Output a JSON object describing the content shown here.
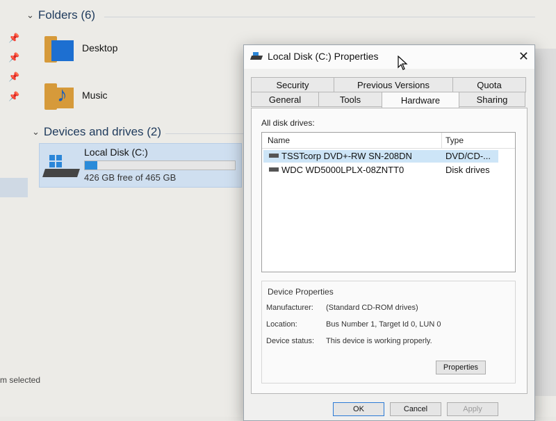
{
  "explorer": {
    "folders_header": "Folders (6)",
    "folders": [
      {
        "label": "Desktop",
        "icon": "desktop-folder-icon"
      },
      {
        "label": "Music",
        "icon": "music-folder-icon"
      }
    ],
    "devices_header": "Devices and drives (2)",
    "drive": {
      "name": "Local Disk (C:)",
      "free_text": "426 GB free of 465 GB",
      "used_fraction": 0.084
    },
    "status_text": "m selected"
  },
  "dialog": {
    "title": "Local Disk (C:) Properties",
    "close_glyph": "✕",
    "tabs_row1": [
      "Security",
      "Previous Versions",
      "Quota"
    ],
    "tabs_row2": [
      "General",
      "Tools",
      "Hardware",
      "Sharing"
    ],
    "active_tab": "Hardware",
    "all_disk_drives_label": "All disk drives:",
    "columns": [
      "Name",
      "Type"
    ],
    "drives": [
      {
        "name": "TSSTcorp DVD+-RW SN-208DN",
        "type": "DVD/CD-..."
      },
      {
        "name": "WDC WD5000LPLX-08ZNTT0",
        "type": "Disk drives"
      }
    ],
    "device_properties": {
      "group_label": "Device Properties",
      "manufacturer_label": "Manufacturer:",
      "manufacturer_value": "(Standard CD-ROM drives)",
      "location_label": "Location:",
      "location_value": "Bus Number 1, Target Id 0, LUN 0",
      "status_label": "Device status:",
      "status_value": "This device is working properly."
    },
    "properties_button": "Properties",
    "ok_button": "OK",
    "cancel_button": "Cancel",
    "apply_button": "Apply"
  },
  "colors": {
    "accent": "#2a8bd9",
    "selection": "#cde5f7"
  }
}
